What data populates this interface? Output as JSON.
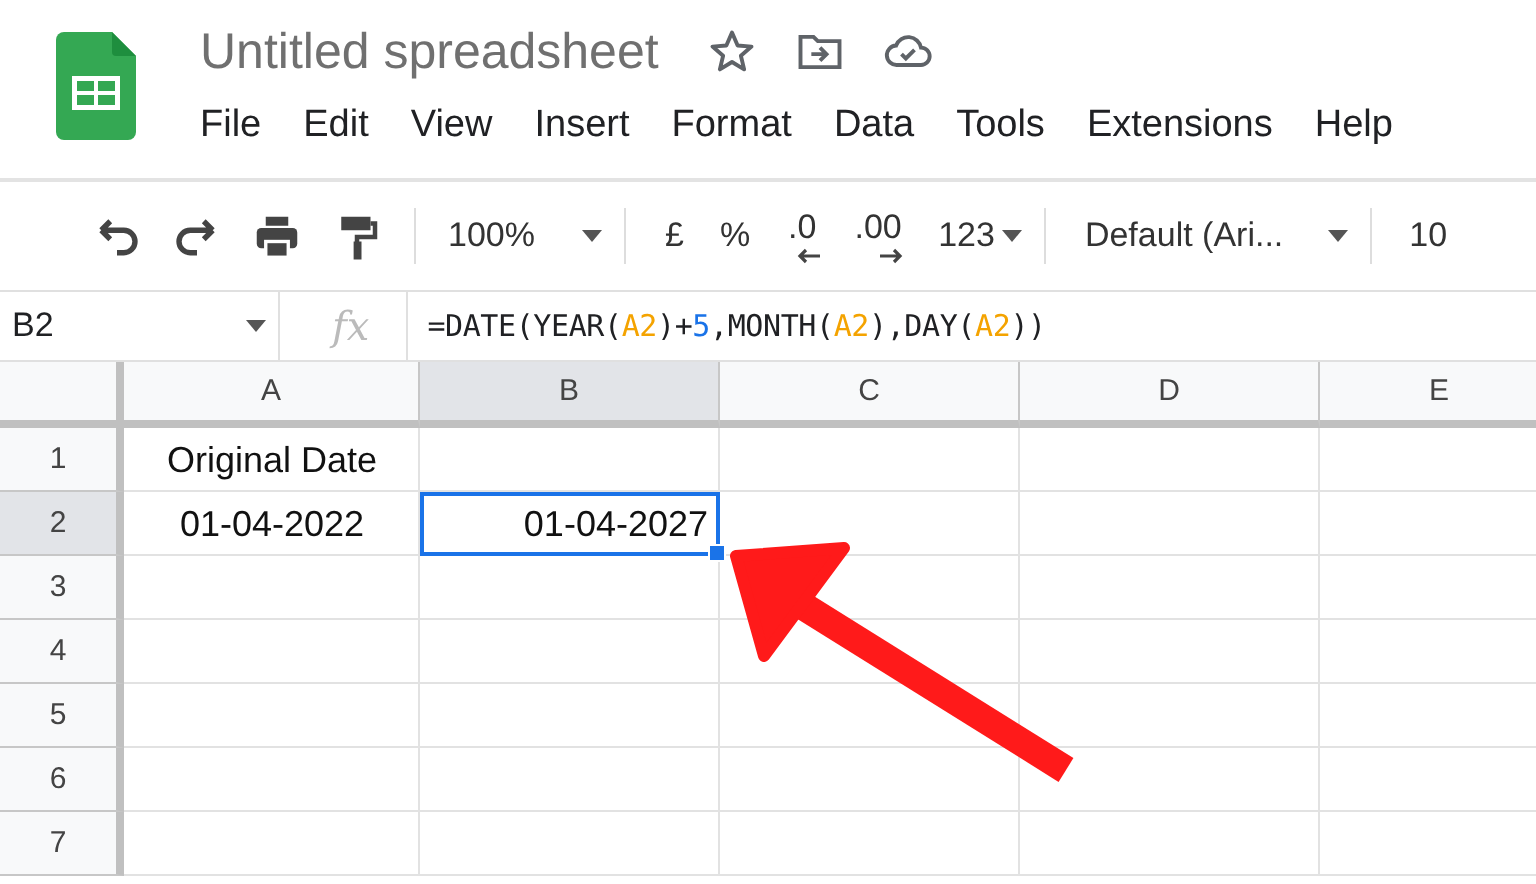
{
  "app": {
    "title": "Untitled spreadsheet",
    "menu": [
      "File",
      "Edit",
      "View",
      "Insert",
      "Format",
      "Data",
      "Tools",
      "Extensions",
      "Help"
    ]
  },
  "toolbar": {
    "zoom": "100%",
    "currency": "£",
    "percent": "%",
    "decrease_decimals": ".0",
    "increase_decimals": ".00",
    "number_format": "123",
    "font": "Default (Ari...",
    "font_size": "10"
  },
  "formula_bar": {
    "name_box": "B2",
    "fx_label": "fx",
    "formula": [
      {
        "text": "=DATE(YEAR(",
        "kind": "plain"
      },
      {
        "text": "A2",
        "kind": "ref"
      },
      {
        "text": ")+",
        "kind": "plain"
      },
      {
        "text": "5",
        "kind": "number"
      },
      {
        "text": ",MONTH(",
        "kind": "plain"
      },
      {
        "text": "A2",
        "kind": "ref"
      },
      {
        "text": "),DAY(",
        "kind": "plain"
      },
      {
        "text": "A2",
        "kind": "ref"
      },
      {
        "text": "))",
        "kind": "plain"
      }
    ]
  },
  "columns": [
    {
      "label": "A",
      "selected": false
    },
    {
      "label": "B",
      "selected": true
    },
    {
      "label": "C",
      "selected": false
    },
    {
      "label": "D",
      "selected": false
    },
    {
      "label": "E",
      "selected": false
    }
  ],
  "rows": [
    {
      "label": "1",
      "selected": false,
      "cells": [
        {
          "text": "Original Date",
          "kind": "value",
          "selected": false
        },
        null,
        null,
        null,
        null
      ]
    },
    {
      "label": "2",
      "selected": true,
      "cells": [
        {
          "text": "01-04-2022",
          "kind": "value",
          "selected": false
        },
        {
          "text": "01-04-2027",
          "kind": "formula",
          "selected": true
        },
        null,
        null,
        null
      ]
    },
    {
      "label": "3",
      "selected": false,
      "cells": [
        null,
        null,
        null,
        null,
        null
      ]
    },
    {
      "label": "4",
      "selected": false,
      "cells": [
        null,
        null,
        null,
        null,
        null
      ]
    },
    {
      "label": "5",
      "selected": false,
      "cells": [
        null,
        null,
        null,
        null,
        null
      ]
    },
    {
      "label": "6",
      "selected": false,
      "cells": [
        null,
        null,
        null,
        null,
        null
      ]
    },
    {
      "label": "7",
      "selected": false,
      "cells": [
        null,
        null,
        null,
        null,
        null
      ]
    }
  ]
}
